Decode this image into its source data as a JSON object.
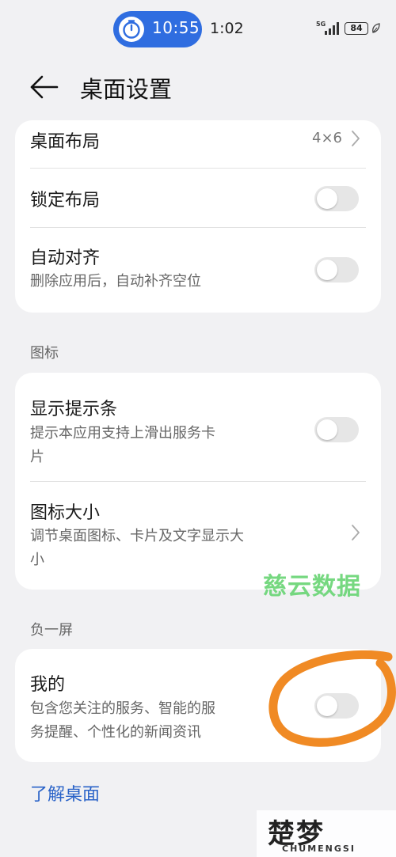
{
  "status_bar": {
    "timer": "10:55",
    "clock": "1:02",
    "network": "5G",
    "battery": "84"
  },
  "header": {
    "title": "桌面设置"
  },
  "layout_card": {
    "desktop_layout": {
      "label": "桌面布局",
      "value": "4×6"
    },
    "lock_layout": {
      "label": "锁定布局",
      "enabled": false
    },
    "auto_align": {
      "label": "自动对齐",
      "description": "删除应用后，自动补齐空位",
      "enabled": false
    }
  },
  "icons_section": {
    "label": "图标",
    "show_hint_bar": {
      "label": "显示提示条",
      "description_line1": "提示本应用支持上滑出服务卡",
      "description_line2": "片",
      "enabled": false
    },
    "icon_size": {
      "label": "图标大小",
      "description_line1": "调节桌面图标、卡片及文字显示大",
      "description_line2": "小"
    }
  },
  "minus_one_section": {
    "label": "负一屏",
    "mine": {
      "label": "我的",
      "description_line1": "包含您关注的服务、智能的服",
      "description_line2": "务提醒、个性化的新闻资讯",
      "enabled": false
    }
  },
  "footer": {
    "learn_link": "了解桌面"
  },
  "watermarks": {
    "green": "慈云数据",
    "logo_main": "楚梦",
    "logo_sub": "CHUMENGSI"
  },
  "colors": {
    "accent_blue": "#2f6de0",
    "link_blue": "#2a63c8",
    "annotation_orange": "#f08a24",
    "toggle_off": "#e6e6e6"
  }
}
